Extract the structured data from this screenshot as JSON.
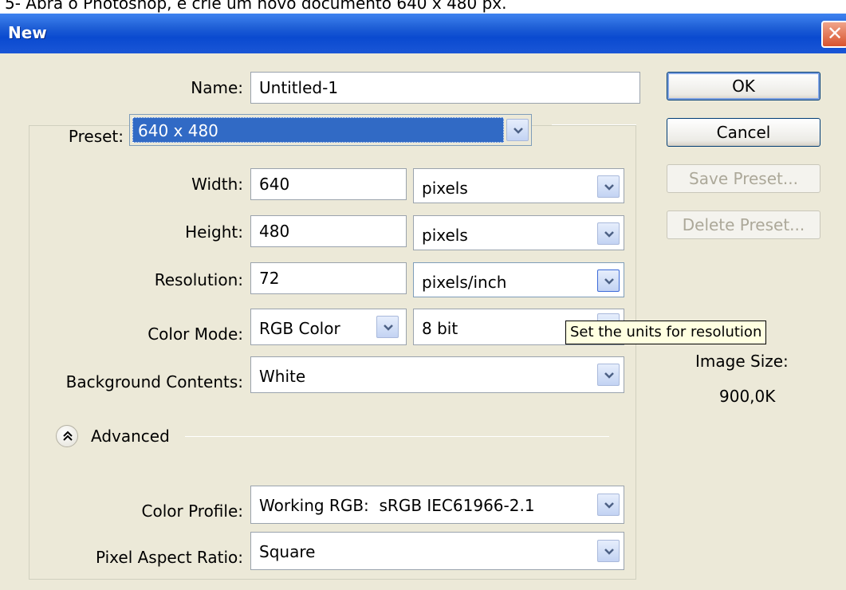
{
  "caption": "5- Abra o Photoshop, e crie um novo documento 640 x 480 px.",
  "window": {
    "title": "New",
    "close_glyph": "✕"
  },
  "form": {
    "name_label": "Name:",
    "name_value": "Untitled-1",
    "preset_label": "Preset:",
    "preset_value": "640 x 480",
    "width_label": "Width:",
    "width_value": "640",
    "width_unit": "pixels",
    "height_label": "Height:",
    "height_value": "480",
    "height_unit": "pixels",
    "resolution_label": "Resolution:",
    "resolution_value": "72",
    "resolution_unit": "pixels/inch",
    "color_mode_label": "Color Mode:",
    "color_mode_value": "RGB Color",
    "bit_depth_value": "8 bit",
    "background_label": "Background Contents:",
    "background_value": "White",
    "advanced_label": "Advanced",
    "color_profile_label": "Color Profile:",
    "color_profile_value": "Working RGB:  sRGB IEC61966-2.1",
    "pixel_aspect_label": "Pixel Aspect Ratio:",
    "pixel_aspect_value": "Square"
  },
  "buttons": {
    "ok": "OK",
    "cancel": "Cancel",
    "save_preset": "Save Preset...",
    "delete_preset": "Delete Preset..."
  },
  "image_size": {
    "label": "Image Size:",
    "value": "900,0K"
  },
  "tooltip": "Set the units for resolution",
  "icons": {
    "dropdown": "chevron-down-icon",
    "advanced": "double-chevron-up-icon",
    "close": "close-icon"
  },
  "colors": {
    "titlebar": "#0a4ad0",
    "selection": "#316ac5",
    "dialog_bg": "#ece9d8",
    "close": "#d8532e"
  }
}
